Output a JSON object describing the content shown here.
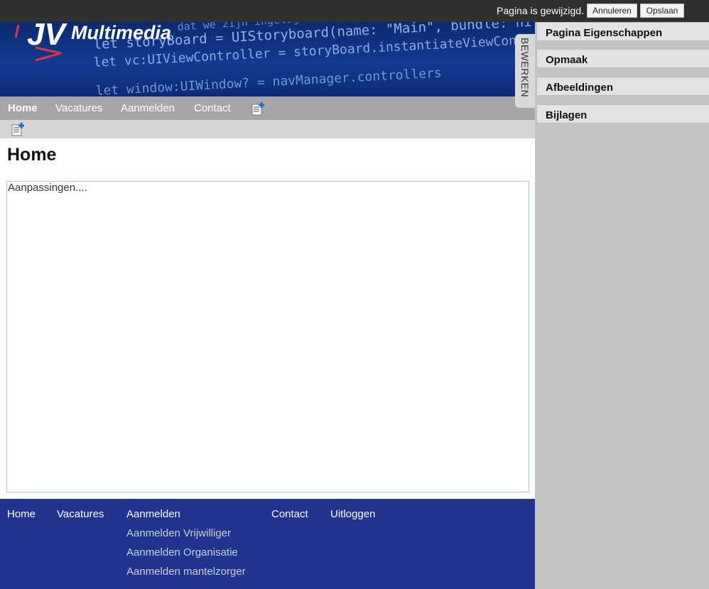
{
  "topbar": {
    "status": "Pagina is gewijzigd.",
    "cancel_label": "Annuleren",
    "save_label": "Opslaan"
  },
  "banner": {
    "logo_mark": "JV",
    "logo_word": "Multimedia",
    "code_lines": [
      "dat we zijn ingelogd",
      "let storyBoard = UIStoryboard(name: \"Main\", bundle: nil)",
      "let vc:UIViewController = storyBoard.instantiateViewController",
      "let window:UIWindow? = navManager.controllers"
    ]
  },
  "nav": {
    "items": [
      {
        "label": "Home",
        "active": true
      },
      {
        "label": "Vacatures",
        "active": false
      },
      {
        "label": "Aanmelden",
        "active": false
      },
      {
        "label": "Contact",
        "active": false
      }
    ],
    "add_icon": "page-add-icon"
  },
  "content": {
    "title": "Home",
    "editor_text": "Aanpassingen...."
  },
  "footer": {
    "items": [
      "Home",
      "Vacatures",
      "Aanmelden",
      "Contact",
      "Uitloggen"
    ],
    "submenu": [
      "Aanmelden Vrijwilliger",
      "Aanmelden Organisatie",
      "Aanmelden mantelzorger"
    ]
  },
  "sidepanel": {
    "tab_label": "BEWERKEN",
    "sections": [
      "Pagina Eigenschappen",
      "Opmaak",
      "Afbeeldingen",
      "Bijlagen"
    ]
  },
  "colors": {
    "topbar": "#2f2f2f",
    "nav": "#a6a6a6",
    "footer": "#20348e",
    "sidepanel": "#c4c4c4"
  }
}
